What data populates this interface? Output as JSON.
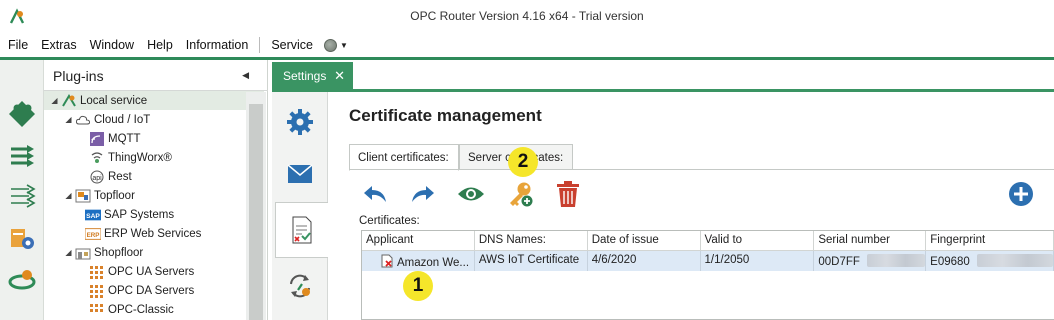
{
  "window": {
    "title": "OPC Router Version 4.16 x64 - Trial version",
    "app_icon": "opc-router-logo-icon"
  },
  "menu": {
    "items": [
      "File",
      "Extras",
      "Window",
      "Help",
      "Information"
    ],
    "service_label": "Service",
    "service_status_color": "#7d857d"
  },
  "plugins_panel": {
    "title": "Plug-ins",
    "tree": [
      {
        "label": "Local service",
        "level": 0,
        "expanded": true,
        "selected": true,
        "icon": "local-service-icon"
      },
      {
        "label": "Cloud / IoT",
        "level": 1,
        "expanded": true,
        "icon": "cloud-icon"
      },
      {
        "label": "MQTT",
        "level": 2,
        "icon": "mqtt-icon"
      },
      {
        "label": "ThingWorx®",
        "level": 2,
        "icon": "thingworx-icon"
      },
      {
        "label": "Rest",
        "level": 2,
        "icon": "rest-icon"
      },
      {
        "label": "Topfloor",
        "level": 1,
        "expanded": true,
        "icon": "topfloor-icon"
      },
      {
        "label": "SAP Systems",
        "level": 2,
        "icon": "sap-icon"
      },
      {
        "label": "ERP Web Services",
        "level": 2,
        "icon": "erp-icon"
      },
      {
        "label": "Shopfloor",
        "level": 1,
        "expanded": true,
        "icon": "shopfloor-icon"
      },
      {
        "label": "OPC UA Servers",
        "level": 2,
        "icon": "opc-ua-icon"
      },
      {
        "label": "OPC DA Servers",
        "level": 2,
        "icon": "opc-da-icon"
      },
      {
        "label": "OPC-Classic",
        "level": 2,
        "icon": "opc-classic-icon"
      }
    ]
  },
  "tabs": {
    "settings_label": "Settings",
    "close_glyph": "✕"
  },
  "content": {
    "title": "Certificate management",
    "subtabs": [
      "Client certificates:",
      "Server certificates:"
    ],
    "certificates_label": "Certificates:",
    "columns": [
      "Applicant",
      "DNS Names:",
      "Date of issue",
      "Valid to",
      "Serial number",
      "Fingerprint"
    ],
    "rows": [
      {
        "applicant": "Amazon We...",
        "dns": "AWS IoT Certificate",
        "issued": "4/6/2020",
        "valid_to": "1/1/2050",
        "serial": "00D7FF",
        "fingerprint": "E09680"
      }
    ],
    "toolbar_icons": [
      "undo-icon",
      "redo-icon",
      "view-icon",
      "add-key-icon",
      "delete-icon",
      "add-icon"
    ]
  },
  "annotations": {
    "badge_1": "1",
    "badge_2": "2",
    "color": "#f5e62a"
  }
}
